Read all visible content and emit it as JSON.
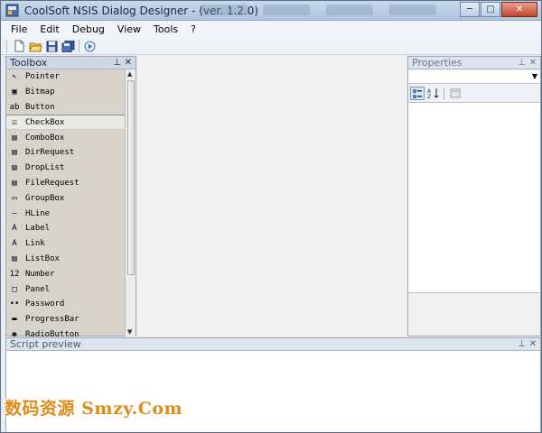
{
  "window": {
    "title": "CoolSoft NSIS Dialog Designer - (ver. 1.2.0)",
    "controls": {
      "minimize": "─",
      "maximize": "□",
      "close": "✕"
    }
  },
  "menu": [
    "File",
    "Edit",
    "Debug",
    "View",
    "Tools",
    "?"
  ],
  "toolbar": {
    "icons": [
      "new-file-icon",
      "open-folder-icon",
      "save-icon",
      "save-all-icon",
      "run-icon"
    ]
  },
  "toolbox": {
    "title": "Toolbox",
    "pin": "⊥",
    "close": "✕",
    "items": [
      {
        "label": "Pointer",
        "icon": "↖"
      },
      {
        "label": "Bitmap",
        "icon": "▣"
      },
      {
        "label": "Button",
        "icon": "ab"
      },
      {
        "label": "CheckBox",
        "icon": "☑"
      },
      {
        "label": "ComboBox",
        "icon": "▤"
      },
      {
        "label": "DirRequest",
        "icon": "▤"
      },
      {
        "label": "DropList",
        "icon": "▤"
      },
      {
        "label": "FileRequest",
        "icon": "▤"
      },
      {
        "label": "GroupBox",
        "icon": "▭"
      },
      {
        "label": "HLine",
        "icon": "—"
      },
      {
        "label": "Label",
        "icon": "A"
      },
      {
        "label": "Link",
        "icon": "A"
      },
      {
        "label": "ListBox",
        "icon": "▤"
      },
      {
        "label": "Number",
        "icon": "12"
      },
      {
        "label": "Panel",
        "icon": "□"
      },
      {
        "label": "Password",
        "icon": "••"
      },
      {
        "label": "ProgressBar",
        "icon": "▬"
      },
      {
        "label": "RadioButton",
        "icon": "◉"
      }
    ],
    "selected_index": 3
  },
  "properties": {
    "title": "Properties",
    "pin": "⊥",
    "close": "✕"
  },
  "script_preview": {
    "title": "Script preview",
    "pin": "⊥",
    "close": "✕"
  },
  "watermark": "数码资源 Smzy.Com",
  "colors": {
    "watermark": "#e08a18",
    "title_bar": "#aec4de",
    "toolbox_bg": "#d8d4cc"
  }
}
